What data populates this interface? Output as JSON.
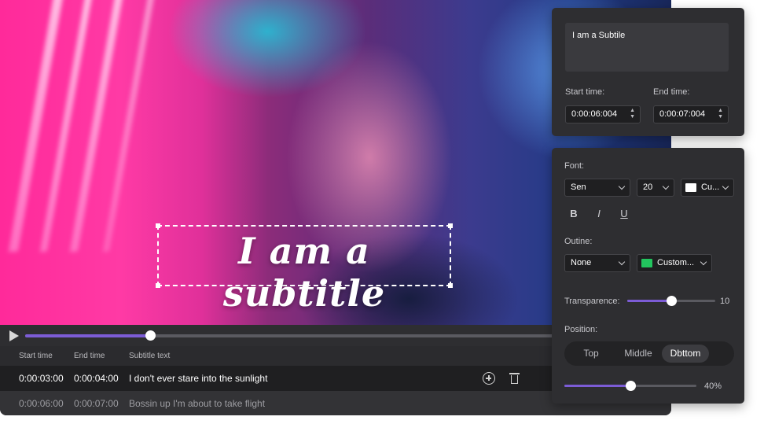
{
  "video": {
    "overlay_subtitle": "I am a subtitle",
    "playback_progress": 0.227
  },
  "list": {
    "headers": [
      "Start time",
      "End time",
      "Subtitle text"
    ],
    "rows": [
      {
        "start": "0:00:03:00",
        "end": "0:00:04:00",
        "text": "I don't ever stare into the sunlight"
      },
      {
        "start": "0:00:06:00",
        "end": "0:00:07:00",
        "text": "Bossin up I'm about to take flight"
      }
    ]
  },
  "edit_panel": {
    "text_value": "I am a Subtile",
    "start_label": "Start time:",
    "end_label": "End time:",
    "start_value": "0:00:06:004",
    "end_value": "0:00:07:004"
  },
  "style_panel": {
    "font_label": "Font:",
    "font_family": "Sen",
    "font_size": "20",
    "font_color_label": "Cu...",
    "font_color": "#ffffff",
    "format_buttons": [
      "B",
      "I",
      "U"
    ],
    "outline_label": "Outine:",
    "outline_value": "None",
    "outline_color_label": "Custom...",
    "outline_color": "#22c55e",
    "transparence_label": "Transparence:",
    "transparence_value": "10",
    "transparence_level": 0.5,
    "position_label": "Position:",
    "position_options": [
      "Top",
      "Middle",
      "Dbttom"
    ],
    "position_selected": "Dbttom",
    "bottom_slider_value": "40%",
    "bottom_slider_level": 0.5
  },
  "colors": {
    "accent": "#7c5cd6",
    "panel_bg": "#2e2e31"
  },
  "icons": [
    "play-icon",
    "add-icon",
    "trash-icon",
    "chevron-down-icon",
    "spinner-arrows-icon",
    "bold-icon",
    "italic-icon",
    "underline-icon"
  ]
}
